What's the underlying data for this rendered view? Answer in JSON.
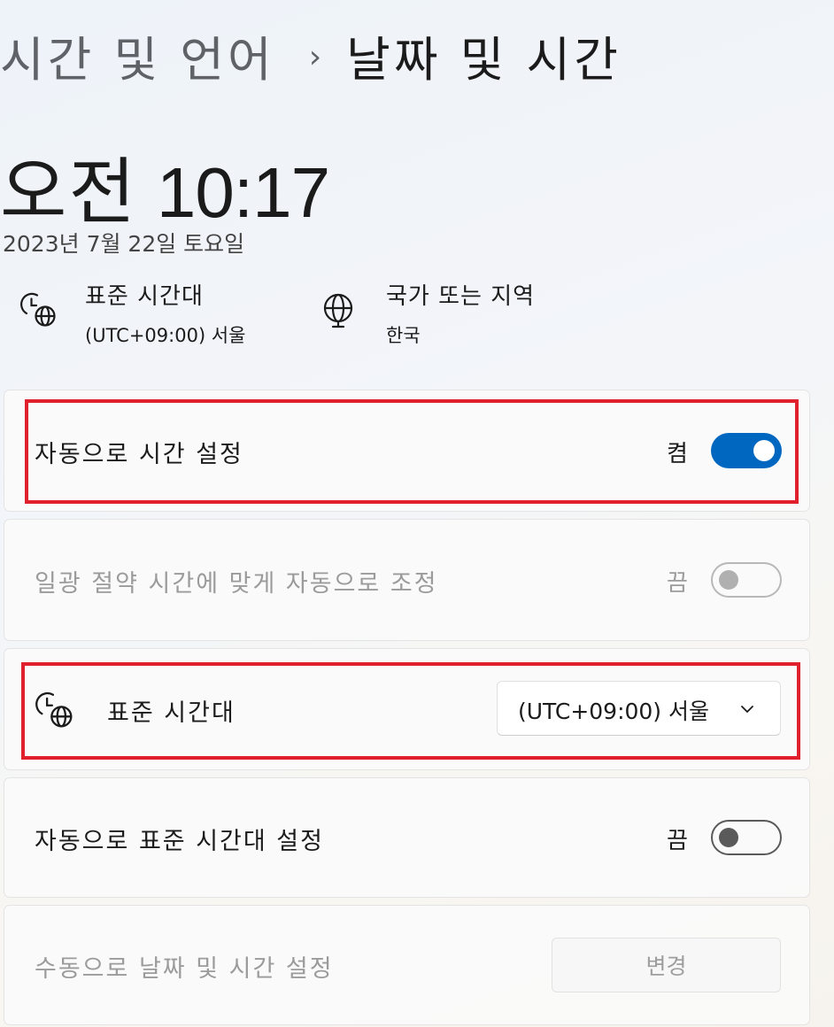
{
  "breadcrumb": {
    "parent": "시간 및 언어",
    "separator": "›",
    "current": "날짜 및 시간"
  },
  "clock": {
    "ampm": "오전",
    "time": "10:17",
    "date": "2023년 7월 22일 토요일"
  },
  "info": {
    "timezone": {
      "icon": "clock-globe-icon",
      "title": "표준 시간대",
      "value": "(UTC+09:00) 서울"
    },
    "region": {
      "icon": "globe-icon",
      "title": "국가 또는 지역",
      "value": "한국"
    }
  },
  "settings": {
    "auto_time": {
      "label": "자동으로 시간 설정",
      "state": "켬",
      "on": true
    },
    "dst": {
      "label": "일광 절약 시간에 맞게 자동으로 조정",
      "state": "끔",
      "on": false,
      "disabled": true
    },
    "timezone": {
      "icon": "clock-globe-icon",
      "label": "표준 시간대",
      "selected": "(UTC+09:00) 서울",
      "chevron": "chevron-down-icon"
    },
    "auto_timezone": {
      "label": "자동으로 표준 시간대 설정",
      "state": "끔",
      "on": false
    },
    "manual": {
      "label": "수동으로 날짜 및 시간 설정",
      "button": "변경",
      "disabled": true
    }
  },
  "colors": {
    "accent": "#0067c0",
    "highlight": "#e0202c"
  }
}
